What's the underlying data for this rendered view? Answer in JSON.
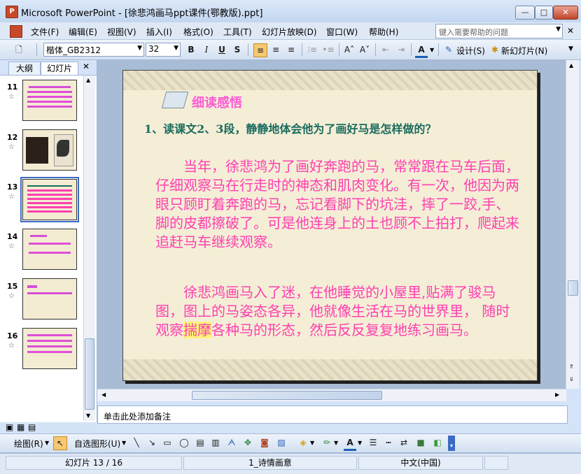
{
  "window": {
    "title": "Microsoft PowerPoint - [徐悲鸿画马ppt课件(鄂教版).ppt]",
    "app_icon": "P",
    "min_label": "—",
    "max_label": "□",
    "close_label": "✕"
  },
  "menu": {
    "items": [
      "文件(F)",
      "编辑(E)",
      "视图(V)",
      "插入(I)",
      "格式(O)",
      "工具(T)",
      "幻灯片放映(D)",
      "窗口(W)",
      "帮助(H)"
    ],
    "help_placeholder": "键入需要帮助的问题"
  },
  "toolbar": {
    "font_name": "楷体_GB2312",
    "font_size": "32",
    "bold": "B",
    "italic": "I",
    "underline": "U",
    "shadow": "S",
    "font_color_glyph": "A",
    "design_label": "设计(S)",
    "new_slide_label": "新幻灯片(N)"
  },
  "panel": {
    "tab_outline": "大纲",
    "tab_slides": "幻灯片",
    "close": "✕",
    "slides": [
      {
        "num": "11",
        "star": "☆"
      },
      {
        "num": "12",
        "star": "☆"
      },
      {
        "num": "13",
        "star": "☆"
      },
      {
        "num": "14",
        "star": "☆"
      },
      {
        "num": "15",
        "star": "☆"
      },
      {
        "num": "16",
        "star": "☆"
      }
    ]
  },
  "slide": {
    "heading": "细读感悟",
    "question": "1、读课文2、3段，静静地体会他为了画好马是怎样做的？",
    "para1": "当年，徐悲鸿为了画好奔跑的马，常常跟在马车后面，仔细观察马在行走时的神态和肌肉变化。有一次，他因为两眼只顾盯着奔跑的马，忘记看脚下的坑洼，摔了一跤,手、脚的皮都擦破了。可是他连身上的土也顾不上拍打，爬起来追赶马车继续观察。",
    "para2_before": "徐悲鸿画马入了迷，在他睡觉的小屋里,贴满了骏马图，图上的马姿态各异，他就像生活在马的世界里， 随时观察",
    "para2_highlight": "揣摩",
    "para2_after": "各种马的形态，然后反反复复地练习画马。"
  },
  "notes": {
    "placeholder": "单击此处添加备注"
  },
  "drawbar": {
    "draw_label": "绘图(R)",
    "autoshape_label": "自选图形(U)"
  },
  "status": {
    "slide_info": "幻灯片 13 / 16",
    "design_name": "1_诗情画意",
    "language": "中文(中国)"
  }
}
